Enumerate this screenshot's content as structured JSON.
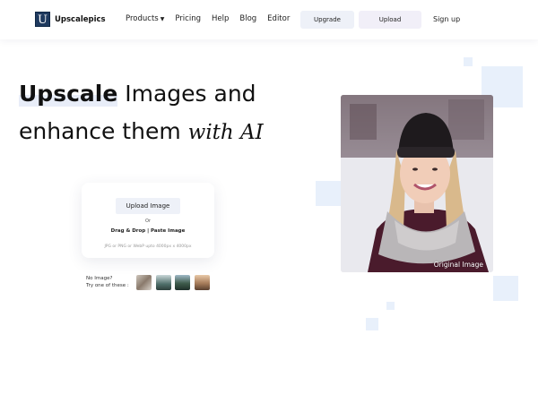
{
  "header": {
    "logo_letter": "U",
    "brand": "Upscalepics",
    "nav": [
      {
        "label": "Products"
      },
      {
        "label": "Pricing"
      },
      {
        "label": "Help"
      },
      {
        "label": "Blog"
      },
      {
        "label": "Editor"
      }
    ],
    "upgrade_label": "Upgrade",
    "upload_label": "Upload",
    "signup_label": "Sign up"
  },
  "hero": {
    "highlight": "Upscale",
    "line1_rest": " Images and",
    "line2": "enhance them ",
    "line2_script": "with AI"
  },
  "upload_card": {
    "button_label": "Upload Image",
    "or_text": "Or",
    "drag_text": "Drag & Drop | Paste Image",
    "hint": "JPG or PNG or WebP upto 4000px x 4000px"
  },
  "samples": {
    "line1": "No Image?",
    "line2": "Try one of these :"
  },
  "preview": {
    "caption": "Original Image"
  },
  "colors": {
    "brand": "#1f3a5f",
    "accent_bg": "#eef1f8",
    "decor": "#e8f0fb"
  }
}
